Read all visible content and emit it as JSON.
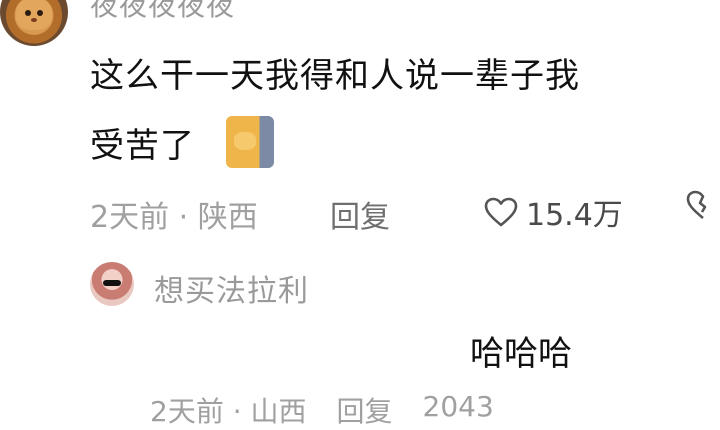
{
  "comment": {
    "username": "夜夜夜夜夜",
    "text_line1": "这么干一天我得和人说一辈子我",
    "text_line2": "受苦了",
    "time_location": "2天前 · 陕西",
    "reply_label": "回复",
    "likes": "15.4万"
  },
  "reply": {
    "username": "想买法拉利",
    "text": "哈哈哈",
    "time_location": "2天前 · 山西",
    "reply_label": "回复",
    "likes": "2043"
  },
  "icons": {
    "like": "heart-outline-icon",
    "dislike": "broken-heart-icon"
  }
}
